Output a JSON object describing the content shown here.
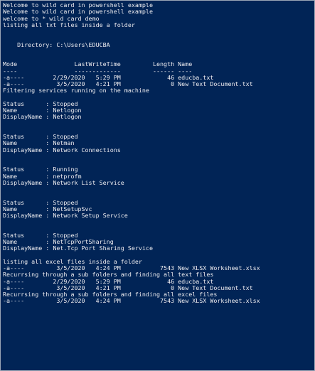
{
  "console": {
    "background_color": "#012456",
    "text_color": "#eeedf0",
    "lines": [
      "Welcome to wild card in powershell example",
      "Welcome to wild card in powershell example",
      "welcome to * wild card demo",
      "listing all txt files inside a folder",
      "",
      "",
      "    Directory: C:\\Users\\EDUCBA",
      "",
      "",
      "Mode                LastWriteTime         Length Name",
      "----                -------------         ------ ----",
      "-a----        2/29/2020   5:29 PM             46 educba.txt",
      "-a----         3/5/2020   4:21 PM              0 New Text Document.txt",
      "Filtering services running on the machine",
      "",
      "Status      : Stopped",
      "Name        : Netlogon",
      "DisplayName : Netlogon",
      "",
      "",
      "Status      : Stopped",
      "Name        : Netman",
      "DisplayName : Network Connections",
      "",
      "",
      "Status      : Running",
      "Name        : netprofm",
      "DisplayName : Network List Service",
      "",
      "",
      "Status      : Stopped",
      "Name        : NetSetupSvc",
      "DisplayName : Network Setup Service",
      "",
      "",
      "Status      : Stopped",
      "Name        : NetTcpPortSharing",
      "DisplayName : Net.Tcp Port Sharing Service",
      "",
      "listing all excel files inside a folder",
      "-a----         3/5/2020   4:24 PM           7543 New XLSX Worksheet.xlsx",
      "Recurrsing through a sub folders and finding all text files",
      "-a----        2/29/2020   5:29 PM             46 educba.txt",
      "-a----         3/5/2020   4:21 PM              0 New Text Document.txt",
      "Recurrsing through a sub folders and finding all excel files",
      "-a----         3/5/2020   4:24 PM           7543 New XLSX Worksheet.xlsx"
    ]
  }
}
